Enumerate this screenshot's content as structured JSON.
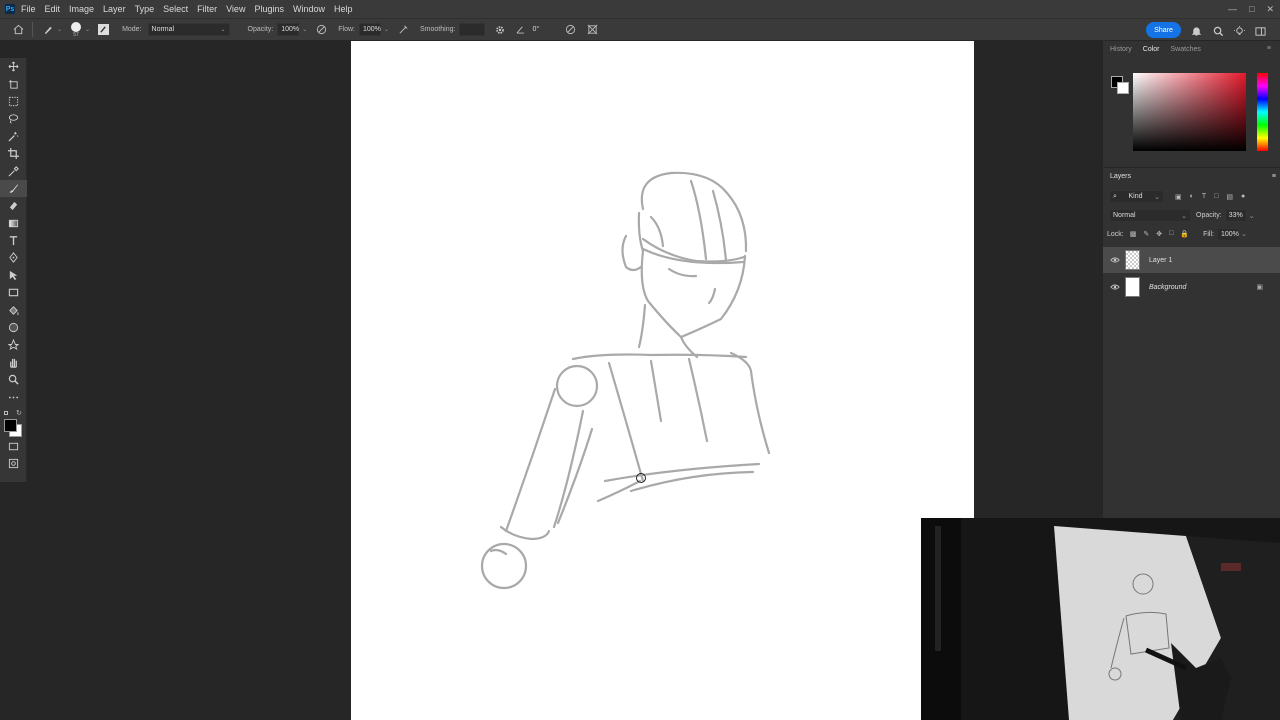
{
  "menubar": {
    "logo": "Ps",
    "items": [
      "File",
      "Edit",
      "Image",
      "Layer",
      "Type",
      "Select",
      "Filter",
      "View",
      "Plugins",
      "Window",
      "Help"
    ]
  },
  "options": {
    "brush_size": "57",
    "mode_label": "Mode:",
    "mode_value": "Normal",
    "opacity_label": "Opacity:",
    "opacity_value": "100%",
    "flow_label": "Flow:",
    "flow_value": "100%",
    "smoothing_label": "Smoothing:",
    "smoothing_value": "",
    "angle_value": "0°",
    "share_label": "Share"
  },
  "panel": {
    "tabs": [
      "History",
      "Color",
      "Swatches"
    ],
    "active_tab": "Color",
    "layers_title": "Layers",
    "kind_label": "Kind",
    "blend_mode": "Normal",
    "opacity_label": "Opacity:",
    "opacity_value": "33%",
    "lock_label": "Lock:",
    "fill_label": "Fill:",
    "fill_value": "100%",
    "layers": [
      {
        "name": "Layer 1",
        "selected": true
      },
      {
        "name": "Background",
        "selected": false,
        "locked": true
      }
    ]
  },
  "colors": {
    "foreground": "#000000",
    "background": "#ffffff",
    "accent": "#1473e6"
  },
  "icons": {
    "tools": [
      "move-icon",
      "artboard-icon",
      "marquee-icon",
      "lasso-icon",
      "magic-wand-icon",
      "crop-icon",
      "eyedropper-icon",
      "brush-icon",
      "eraser-icon",
      "gradient-icon",
      "type-icon",
      "pen-icon",
      "path-select-icon",
      "rectangle-icon",
      "paint-bucket-icon",
      "ellipse-icon",
      "sharpen-icon",
      "hand-icon",
      "zoom-icon",
      "more-icon"
    ]
  }
}
